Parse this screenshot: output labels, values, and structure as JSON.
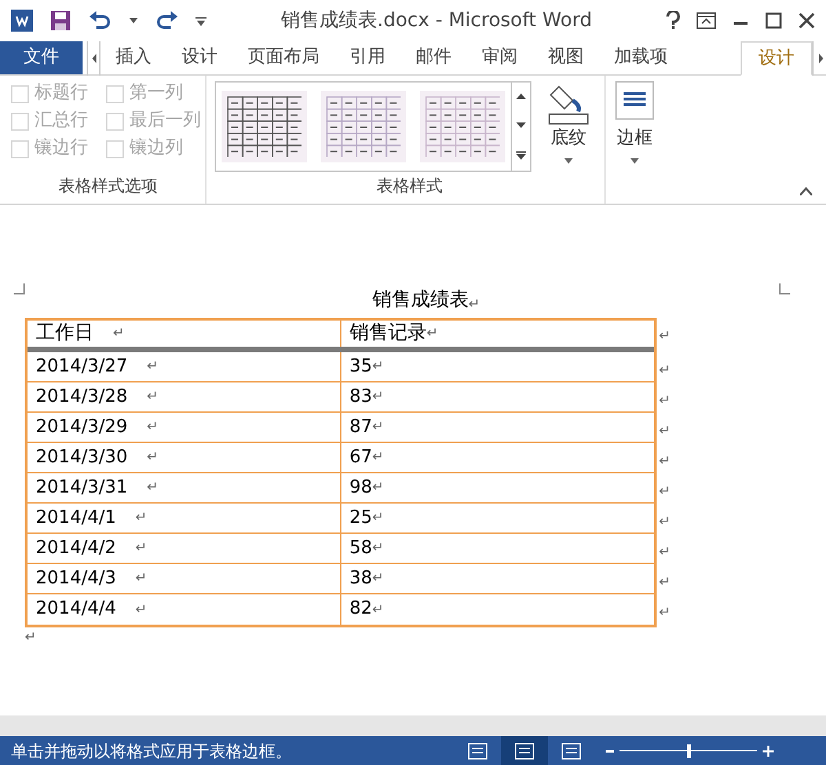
{
  "window": {
    "title": "销售成绩表.docx - Microsoft Word"
  },
  "tabs": [
    {
      "label": "文件",
      "kind": "file",
      "selected": false
    },
    {
      "label": "插入",
      "kind": "tab",
      "selected": false
    },
    {
      "label": "设计",
      "kind": "tab",
      "selected": false
    },
    {
      "label": "页面布局",
      "kind": "tab",
      "selected": false
    },
    {
      "label": "引用",
      "kind": "tab",
      "selected": false
    },
    {
      "label": "邮件",
      "kind": "tab",
      "selected": false
    },
    {
      "label": "审阅",
      "kind": "tab",
      "selected": false
    },
    {
      "label": "视图",
      "kind": "tab",
      "selected": false
    },
    {
      "label": "加载项",
      "kind": "tab",
      "selected": false
    },
    {
      "label": "设计",
      "kind": "context",
      "selected": true
    }
  ],
  "style_options": {
    "label": "表格样式选项",
    "options": [
      {
        "label": "标题行",
        "checked": false,
        "disabled": true
      },
      {
        "label": "第一列",
        "checked": false,
        "disabled": true
      },
      {
        "label": "汇总行",
        "checked": false,
        "disabled": true
      },
      {
        "label": "最后一列",
        "checked": false,
        "disabled": true
      },
      {
        "label": "镶边行",
        "checked": false,
        "disabled": true
      },
      {
        "label": "镶边列",
        "checked": false,
        "disabled": true
      }
    ]
  },
  "table_styles": {
    "label": "表格样式",
    "styles": [
      {
        "selected": false
      },
      {
        "selected": false
      },
      {
        "selected": false
      }
    ]
  },
  "shading": {
    "label": "底纹"
  },
  "borders": {
    "label": "边框"
  },
  "document": {
    "title": "销售成绩表",
    "title_mark": "↵",
    "table": {
      "columns": [
        {
          "text": "工作日",
          "mark": "↵"
        },
        {
          "text": "销售记录",
          "mark": "↵"
        }
      ],
      "rows": [
        [
          {
            "text": "2014/3/27",
            "mark": "↵"
          },
          {
            "text": "35",
            "mark": "↵"
          }
        ],
        [
          {
            "text": "2014/3/28",
            "mark": "↵"
          },
          {
            "text": "83",
            "mark": "↵"
          }
        ],
        [
          {
            "text": "2014/3/29",
            "mark": "↵"
          },
          {
            "text": "87",
            "mark": "↵"
          }
        ],
        [
          {
            "text": "2014/3/30",
            "mark": "↵"
          },
          {
            "text": "67",
            "mark": "↵"
          }
        ],
        [
          {
            "text": "2014/3/31",
            "mark": "↵"
          },
          {
            "text": "98",
            "mark": "↵"
          }
        ],
        [
          {
            "text": "2014/4/1",
            "mark": "↵"
          },
          {
            "text": "25",
            "mark": "↵"
          }
        ],
        [
          {
            "text": "2014/4/2",
            "mark": "↵"
          },
          {
            "text": "58",
            "mark": "↵"
          }
        ],
        [
          {
            "text": "2014/4/3",
            "mark": "↵"
          },
          {
            "text": "38",
            "mark": "↵"
          }
        ],
        [
          {
            "text": "2014/4/4",
            "mark": "↵"
          },
          {
            "text": "82",
            "mark": "↵"
          }
        ]
      ]
    },
    "after_mark": "↵"
  },
  "status_bar": {
    "message": "单击并拖动以将格式应用于表格边框。",
    "views": [
      {
        "selected": false
      },
      {
        "selected": true
      },
      {
        "selected": false
      }
    ],
    "zoom": {
      "level": 0.5
    }
  }
}
